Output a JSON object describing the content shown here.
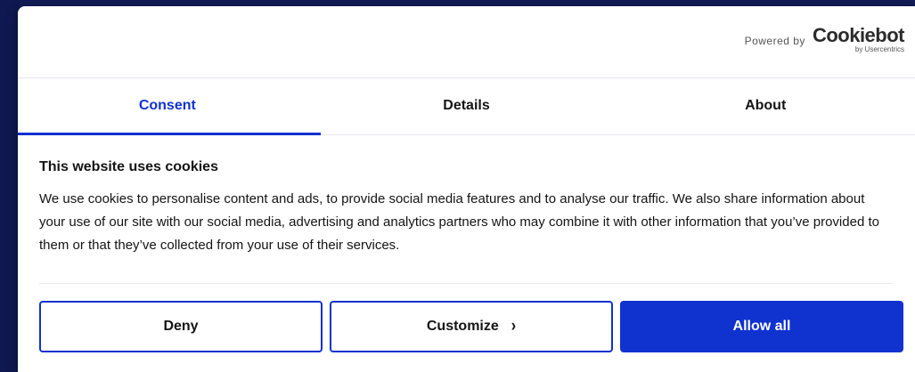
{
  "header": {
    "powered_by": "Powered by",
    "logo_text": "Cookiebot",
    "logo_sub": "by Usercentrics"
  },
  "tabs": [
    {
      "label": "Consent",
      "active": true
    },
    {
      "label": "Details",
      "active": false
    },
    {
      "label": "About",
      "active": false
    }
  ],
  "content": {
    "title": "This website uses cookies",
    "body": "We use cookies to personalise content and ads, to provide social media features and to analyse our traffic. We also share information about your use of our site with our social media, advertising and analytics partners who may combine it with other information that you’ve provided to them or that they’ve collected from your use of their services."
  },
  "buttons": {
    "deny": "Deny",
    "customize": "Customize",
    "allow_all": "Allow all"
  },
  "colors": {
    "accent": "#1032cf",
    "backdrop": "#131c58"
  },
  "icons": {
    "customize_chevron": "chevron-right-icon"
  }
}
